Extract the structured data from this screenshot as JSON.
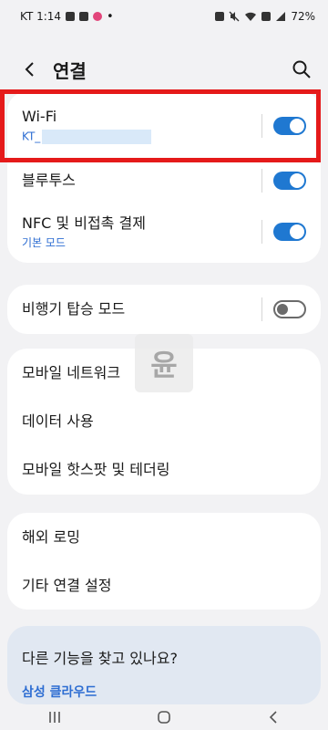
{
  "status_bar": {
    "carrier_time": "KT 1:14",
    "battery": "72%",
    "icons": [
      "gallery-icon",
      "photo-icon",
      "instagram-icon",
      "dot-icon",
      "sim-icon",
      "mute-icon",
      "wifi-icon",
      "hd-volte-icon",
      "signal-icon",
      "battery-icon"
    ]
  },
  "header": {
    "title": "연결",
    "back_icon": "chevron-left-icon",
    "search_icon": "search-icon"
  },
  "connections": [
    {
      "label": "Wi-Fi",
      "sub": "KT_",
      "toggle": true,
      "highlighted": true
    },
    {
      "label": "블루투스",
      "toggle": true
    },
    {
      "label": "NFC 및 비접촉 결제",
      "sub": "기본 모드",
      "toggle": true
    }
  ],
  "airplane": {
    "label": "비행기 탑승 모드",
    "toggle": false
  },
  "mobile": [
    {
      "label": "모바일 네트워크"
    },
    {
      "label": "데이터 사용"
    },
    {
      "label": "모바일 핫스팟 및 테더링"
    }
  ],
  "other": [
    {
      "label": "해외 로밍"
    },
    {
      "label": "기타 연결 설정"
    }
  ],
  "more": {
    "title": "다른 기능을 찾고 있나요?",
    "link": "삼성 클라우드"
  },
  "watermark": {
    "text": "윤"
  },
  "colors": {
    "accent": "#1f78d1",
    "link": "#2d6dd2",
    "highlight": "#e51a1a",
    "background": "#f2f2f4"
  },
  "nav": [
    "recents-icon",
    "home-icon",
    "back-icon"
  ]
}
